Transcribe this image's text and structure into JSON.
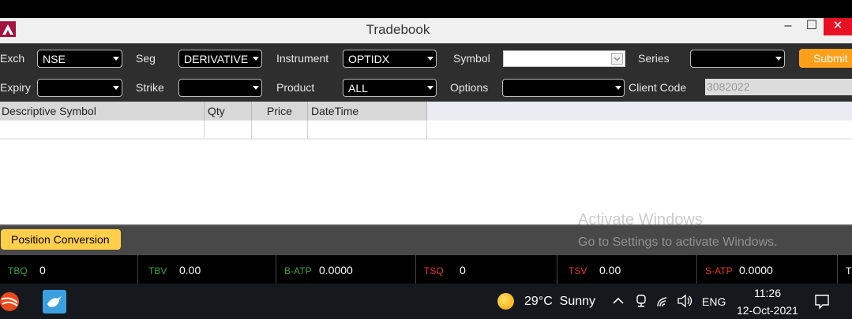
{
  "window": {
    "title": "Tradebook",
    "minimize": "–",
    "maximize": "☐",
    "close": "✕"
  },
  "filters": {
    "exch_label": "Exch",
    "exch_value": "NSE",
    "seg_label": "Seg",
    "seg_value": "DERIVATIVE",
    "instrument_label": "Instrument",
    "instrument_value": "OPTIDX",
    "symbol_label": "Symbol",
    "symbol_value": "",
    "series_label": "Series",
    "series_value": "",
    "submit_label": "Submit",
    "expiry_label": "Expiry",
    "expiry_value": "",
    "strike_label": "Strike",
    "strike_value": "",
    "product_label": "Product",
    "product_value": "ALL",
    "options_label": "Options",
    "options_value": "",
    "client_code_label": "Client Code",
    "client_code_value": "3082022"
  },
  "table": {
    "columns": [
      "Descriptive Symbol",
      "Qty",
      "Price",
      "DateTime"
    ]
  },
  "watermark": {
    "line1": "Activate Windows",
    "line2": "Go to Settings to activate Windows."
  },
  "actions": {
    "position_conversion": "Position Conversion"
  },
  "stats": [
    {
      "key": "TBQ",
      "value": "0"
    },
    {
      "key": "TBV",
      "value": "0.00"
    },
    {
      "key": "B-ATP",
      "value": "0.0000"
    },
    {
      "key": "TSQ",
      "value": "0"
    },
    {
      "key": "TSV",
      "value": "0.00"
    },
    {
      "key": "S-ATP",
      "value": "0.0000"
    },
    {
      "key": "T",
      "value": ""
    }
  ],
  "taskbar": {
    "weather": "29°C  Sunny",
    "language": "ENG",
    "time": "11:26",
    "date": "12-Oct-2021"
  },
  "colors": {
    "buy_green": "#3da53d",
    "sell_red": "#e53935",
    "submit_orange": "#ff9f1a",
    "position_yellow": "#ffce4a"
  }
}
